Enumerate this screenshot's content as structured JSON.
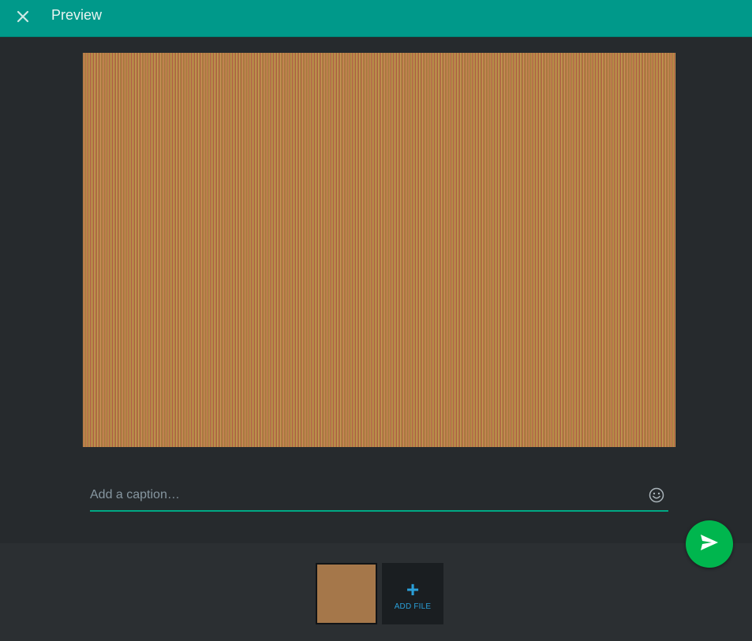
{
  "header": {
    "title": "Preview",
    "close_icon": "close-icon"
  },
  "caption": {
    "placeholder": "Add a caption…",
    "value": "",
    "emoji_icon": "smiley-icon"
  },
  "attachments": {
    "add_file_label": "ADD FILE",
    "add_icon": "plus-icon"
  },
  "send": {
    "icon": "send-icon"
  },
  "colors": {
    "header": "#00998a",
    "accent_underline": "#00a884",
    "send_button": "#00b64e",
    "add_file_text": "#2a9fd8"
  }
}
